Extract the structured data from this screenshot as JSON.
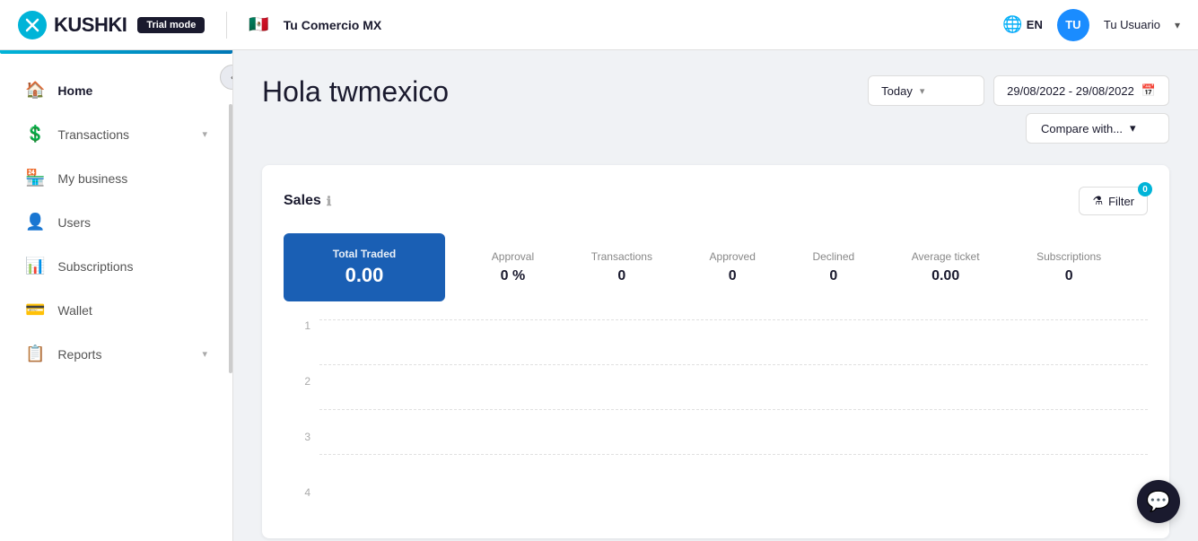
{
  "topnav": {
    "logo_text": "KUSHKI",
    "trial_badge": "Trial mode",
    "merchant_flag": "🇲🇽",
    "merchant_name": "Tu Comercio MX",
    "lang": "EN",
    "user_initials": "TU",
    "user_name": "Tu Usuario"
  },
  "sidebar": {
    "collapse_icon": "‹",
    "items": [
      {
        "label": "Home",
        "icon": "🏠",
        "has_chevron": false
      },
      {
        "label": "Transactions",
        "icon": "💲",
        "has_chevron": true
      },
      {
        "label": "My business",
        "icon": "🏪",
        "has_chevron": false
      },
      {
        "label": "Users",
        "icon": "👤",
        "has_chevron": false
      },
      {
        "label": "Subscriptions",
        "icon": "📊",
        "has_chevron": false
      },
      {
        "label": "Wallet",
        "icon": "💳",
        "has_chevron": false
      },
      {
        "label": "Reports",
        "icon": "📋",
        "has_chevron": false
      }
    ]
  },
  "page": {
    "title": "Hola twmexico",
    "date_dropdown_label": "Today",
    "date_range": "29/08/2022 - 29/08/2022",
    "compare_label": "Compare with...",
    "sales_section_label": "Sales",
    "filter_label": "Filter",
    "filter_badge_count": "0"
  },
  "stats": {
    "total_traded_label": "Total Traded",
    "total_traded_value": "0.00",
    "items": [
      {
        "label": "Approval",
        "value": "0 %"
      },
      {
        "label": "Transactions",
        "value": "0"
      },
      {
        "label": "Approved",
        "value": "0"
      },
      {
        "label": "Declined",
        "value": "0"
      },
      {
        "label": "Average ticket",
        "value": "0.00"
      },
      {
        "label": "Subscriptions",
        "value": "0"
      }
    ]
  },
  "chart": {
    "y_labels": [
      "1",
      "2",
      "3",
      "4"
    ],
    "grid_lines": [
      0,
      25,
      50,
      75,
      100
    ]
  }
}
